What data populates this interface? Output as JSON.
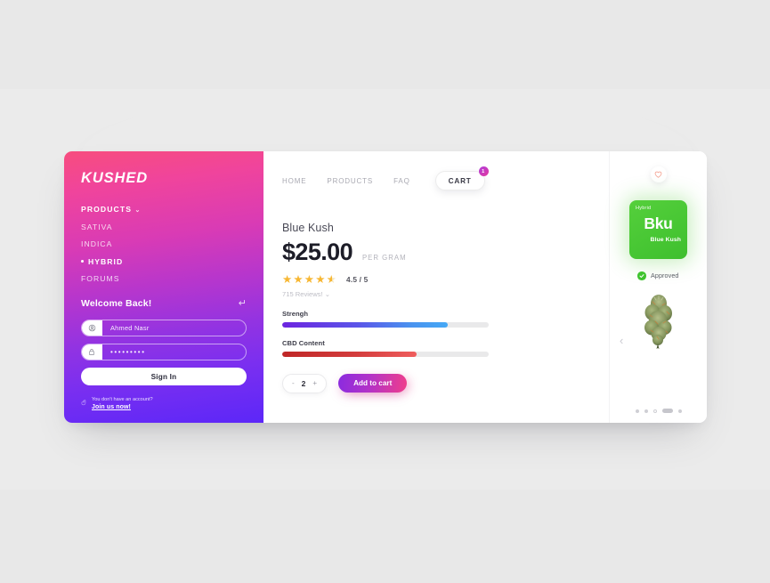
{
  "sidebar": {
    "brand": "KUSHED",
    "nav": [
      {
        "label": "PRODUCTS",
        "chevron": "⌄",
        "style": "strong"
      },
      {
        "label": "SATIVA",
        "style": "normal"
      },
      {
        "label": "INDICA",
        "style": "normal"
      },
      {
        "label": "HYBRID",
        "style": "active"
      },
      {
        "label": "FORUMS",
        "style": "normal"
      }
    ],
    "login": {
      "welcome_title": "Welcome Back!",
      "enter_icon": "↵",
      "username_value": "Ahmed Nasr",
      "username_icon": "user-icon",
      "password_value": "•••••••••",
      "password_icon": "lock-icon",
      "sign_in_label": "Sign In",
      "signup_question": "You don't have an account?",
      "signup_link": "Join us now!"
    }
  },
  "topnav": {
    "links": [
      "HOME",
      "PRODUCTS",
      "FAQ"
    ],
    "cart_label": "CART",
    "cart_count": "1"
  },
  "product": {
    "title": "Blue Kush",
    "price": "$25.00",
    "price_unit": "PER GRAM",
    "stars": "★★★★",
    "half_star": "★",
    "rating_value": "4.5 / 5",
    "reviews": "715 Reviews!",
    "reviews_chevron": "⌄",
    "meters": [
      {
        "label": "Strengh",
        "percent": 80
      },
      {
        "label": "CBD Content",
        "percent": 65
      }
    ],
    "quantity": {
      "minus": "-",
      "value": "2",
      "plus": "+"
    },
    "add_to_cart_label": "Add to cart"
  },
  "rail": {
    "favorite_icon": "heart-icon",
    "strain_type": "Hybrid",
    "strain_abbr": "Bku",
    "strain_name": "Blue Kush",
    "approved_label": "Approved",
    "prev_icon": "‹",
    "pager": [
      "dot",
      "dot",
      "hollow",
      "pill",
      "dot"
    ]
  },
  "colors": {
    "sidebar_top": "#f74d7e",
    "sidebar_bottom": "#5c27f8",
    "accent_pink": "#ef3e8b",
    "accent_purple": "#8b2bdf",
    "strain_green": "#48c734",
    "star_gold": "#f7b733",
    "strength_start": "#6c24e0",
    "strength_end": "#45a8f5",
    "cbd_start": "#bf2626",
    "cbd_end": "#ef5d5d"
  }
}
